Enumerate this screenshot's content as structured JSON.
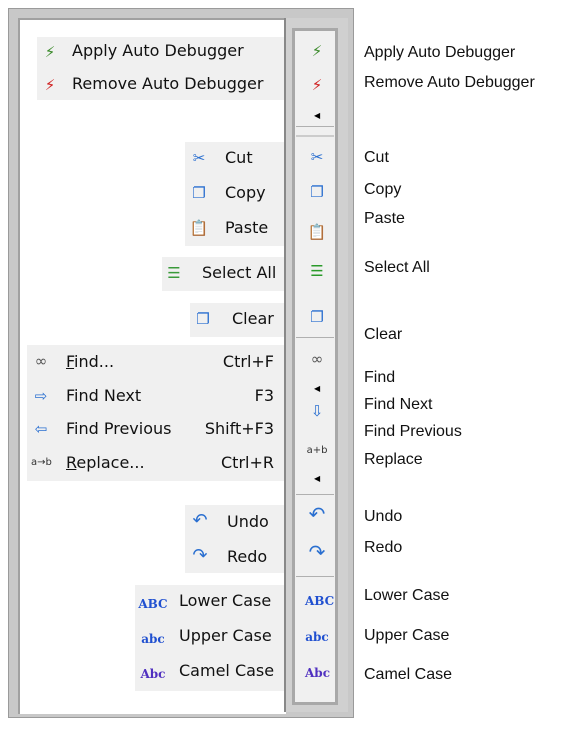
{
  "menu_groups": {
    "debugger": [
      {
        "label": "Apply Auto Debugger",
        "icon": "apply-debugger-icon"
      },
      {
        "label": "Remove Auto Debugger",
        "icon": "remove-debugger-icon"
      }
    ],
    "clipboard": [
      {
        "label": "Cut",
        "icon": "scissors-icon"
      },
      {
        "label": "Copy",
        "icon": "copy-icon"
      },
      {
        "label": "Paste",
        "icon": "paste-icon"
      }
    ],
    "select_all": {
      "label": "Select All",
      "icon": "select-all-icon"
    },
    "clear": {
      "label": "Clear",
      "icon": "clear-icon"
    },
    "find": [
      {
        "label": "Find...",
        "shortcut": "Ctrl+F",
        "icon": "binoculars-icon"
      },
      {
        "label": "Find Next",
        "shortcut": "F3",
        "icon": "find-next-icon"
      },
      {
        "label": "Find Previous",
        "shortcut": "Shift+F3",
        "icon": "find-previous-icon"
      },
      {
        "label": "Replace...",
        "shortcut": "Ctrl+R",
        "icon": "replace-icon"
      }
    ],
    "history": [
      {
        "label": "Undo",
        "icon": "undo-icon"
      },
      {
        "label": "Redo",
        "icon": "redo-icon"
      }
    ],
    "case": [
      {
        "label": "Lower Case",
        "icon": "lower-case-icon"
      },
      {
        "label": "Upper Case",
        "icon": "upper-case-icon"
      },
      {
        "label": "Camel Case",
        "icon": "camel-case-icon"
      }
    ]
  },
  "toolbar_labels": [
    "Apply Auto Debugger",
    "Remove Auto Debugger",
    "Cut",
    "Copy",
    "Paste",
    "Select All",
    "Clear",
    "Find",
    "Find Next",
    "Find Previous",
    "Replace",
    "Undo",
    "Redo",
    "Lower Case",
    "Upper Case",
    "Camel Case"
  ],
  "icon_text": {
    "upper": "ABC",
    "lower": "abc",
    "camel": "Abc"
  },
  "colors": {
    "menu_bg": "#f0f0f0",
    "frame": "#c8c8c8",
    "icon_blue": "#2a6fd0"
  }
}
